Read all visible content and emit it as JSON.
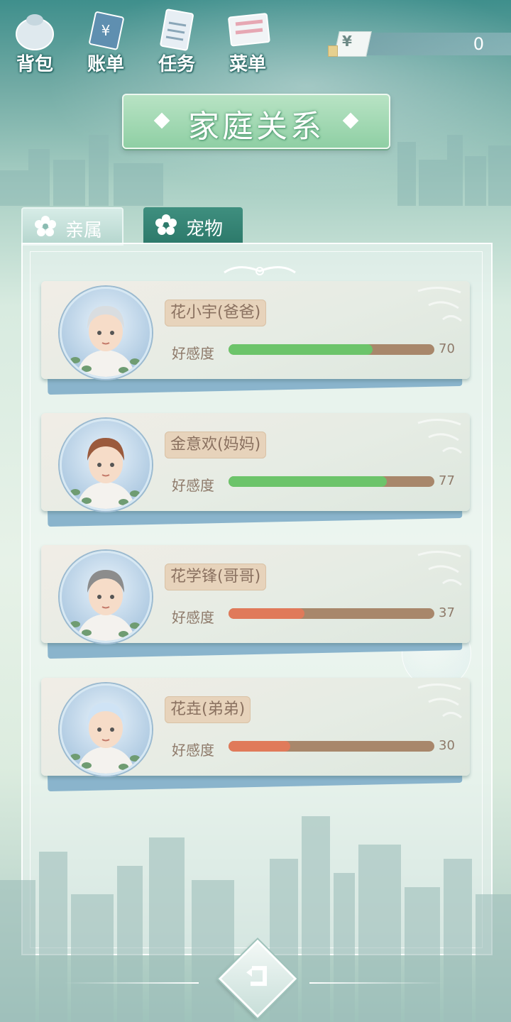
{
  "topbar": {
    "buttons": [
      {
        "label": "背包",
        "icon": "backpack-icon"
      },
      {
        "label": "账单",
        "icon": "bill-icon"
      },
      {
        "label": "任务",
        "icon": "task-icon"
      },
      {
        "label": "菜单",
        "icon": "menu-icon"
      }
    ],
    "money": {
      "symbol": "¥",
      "value": "0"
    }
  },
  "title": "家庭关系",
  "tabs": [
    {
      "label": "亲属",
      "icon": "flower-icon",
      "active": true
    },
    {
      "label": "宠物",
      "icon": "flower-icon",
      "active": false
    }
  ],
  "affection_label": "好感度",
  "members": [
    {
      "name": "花小宇(爸爸)",
      "affection": 70,
      "value_text": "70",
      "bar_color": "#6cc46a",
      "hair": "#d9dde0"
    },
    {
      "name": "金意欢(妈妈)",
      "affection": 77,
      "value_text": "77",
      "bar_color": "#6cc46a",
      "hair": "#9b5a3c"
    },
    {
      "name": "花学锋(哥哥)",
      "affection": 37,
      "value_text": "37",
      "bar_color": "#e07a5a",
      "hair": "#8c8c8c"
    },
    {
      "name": "花垚(弟弟)",
      "affection": 30,
      "value_text": "30",
      "bar_color": "#e07a5a",
      "hair": "#cfe3f5"
    }
  ],
  "colors": {
    "accent": "#8fcfa4",
    "tab_active": "#b5d6ce",
    "tab_inactive": "#2d7a6b"
  }
}
